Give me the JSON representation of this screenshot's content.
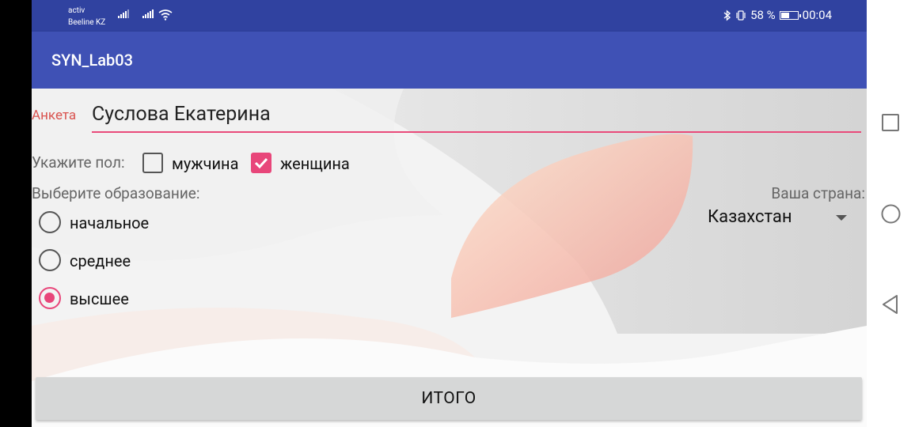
{
  "status_bar": {
    "carrier_line1": "activ",
    "carrier_line2": "Beeline KZ",
    "battery_percent": "58 %",
    "battery_level": 0.58,
    "time": "00:04",
    "icons": [
      "signal-icon",
      "wifi-icon",
      "bluetooth-icon",
      "vibrate-icon",
      "battery-icon"
    ]
  },
  "app": {
    "title": "SYN_Lab03",
    "primary_color": "#3f51b5",
    "status_color": "#3042a0",
    "accent_color": "#e8467a"
  },
  "form": {
    "name_label": "Анкета",
    "name_value": "Суслова Екатерина",
    "gender_label": "Укажите пол:",
    "gender_options": [
      {
        "label": "мужчина",
        "checked": false
      },
      {
        "label": "женщина",
        "checked": true
      }
    ],
    "education_label": "Выберите образование:",
    "education_options": [
      {
        "label": "начальное",
        "selected": false
      },
      {
        "label": "среднее",
        "selected": false
      },
      {
        "label": "высшее",
        "selected": true
      }
    ],
    "country_label": "Ваша страна:",
    "country_value": "Казахстан",
    "submit_label": "ИТОГО"
  },
  "nav": {
    "icons": [
      "recent-apps-icon",
      "home-icon",
      "back-icon"
    ]
  }
}
